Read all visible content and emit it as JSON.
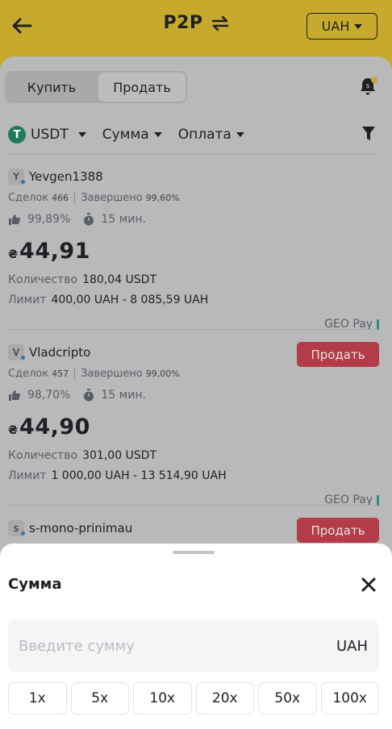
{
  "header": {
    "title": "P2P",
    "currency": "UAH"
  },
  "tabs": {
    "buy": "Купить",
    "sell": "Продать"
  },
  "filters": {
    "asset": "USDT",
    "asset_icon_letter": "T",
    "amount": "Сумма",
    "payment": "Оплата"
  },
  "ads": [
    {
      "avatar": "Y",
      "name": "Yevgen1388",
      "deals_label": "Сделок",
      "deals": "466",
      "completed_label": "Завершено",
      "completed": "99,60%",
      "rating": "99,89%",
      "time": "15 мин.",
      "currency_symbol": "₴",
      "price": "44,91",
      "qty_label": "Количество",
      "qty": "180,04 USDT",
      "limit_label": "Лимит",
      "limit": "400,00 UAH - 8 085,59 UAH",
      "payment": "GEO Pay",
      "action": "Продать"
    },
    {
      "avatar": "V",
      "name": "Vladcripto",
      "deals_label": "Сделок",
      "deals": "457",
      "completed_label": "Завершено",
      "completed": "99,00%",
      "rating": "98,70%",
      "time": "15 мин.",
      "currency_symbol": "₴",
      "price": "44,90",
      "qty_label": "Количество",
      "qty": "301,00 USDT",
      "limit_label": "Лимит",
      "limit": "1 000,00 UAH - 13 514,90 UAH",
      "payment": "GEO Pay",
      "action": "Продать"
    },
    {
      "avatar": "s",
      "name": "s-mono-prinimau"
    }
  ],
  "modal": {
    "title": "Сумма",
    "input_placeholder": "Введите сумму",
    "currency": "UAH",
    "multipliers": [
      "1x",
      "5x",
      "10x",
      "20x",
      "50x",
      "100x"
    ]
  }
}
